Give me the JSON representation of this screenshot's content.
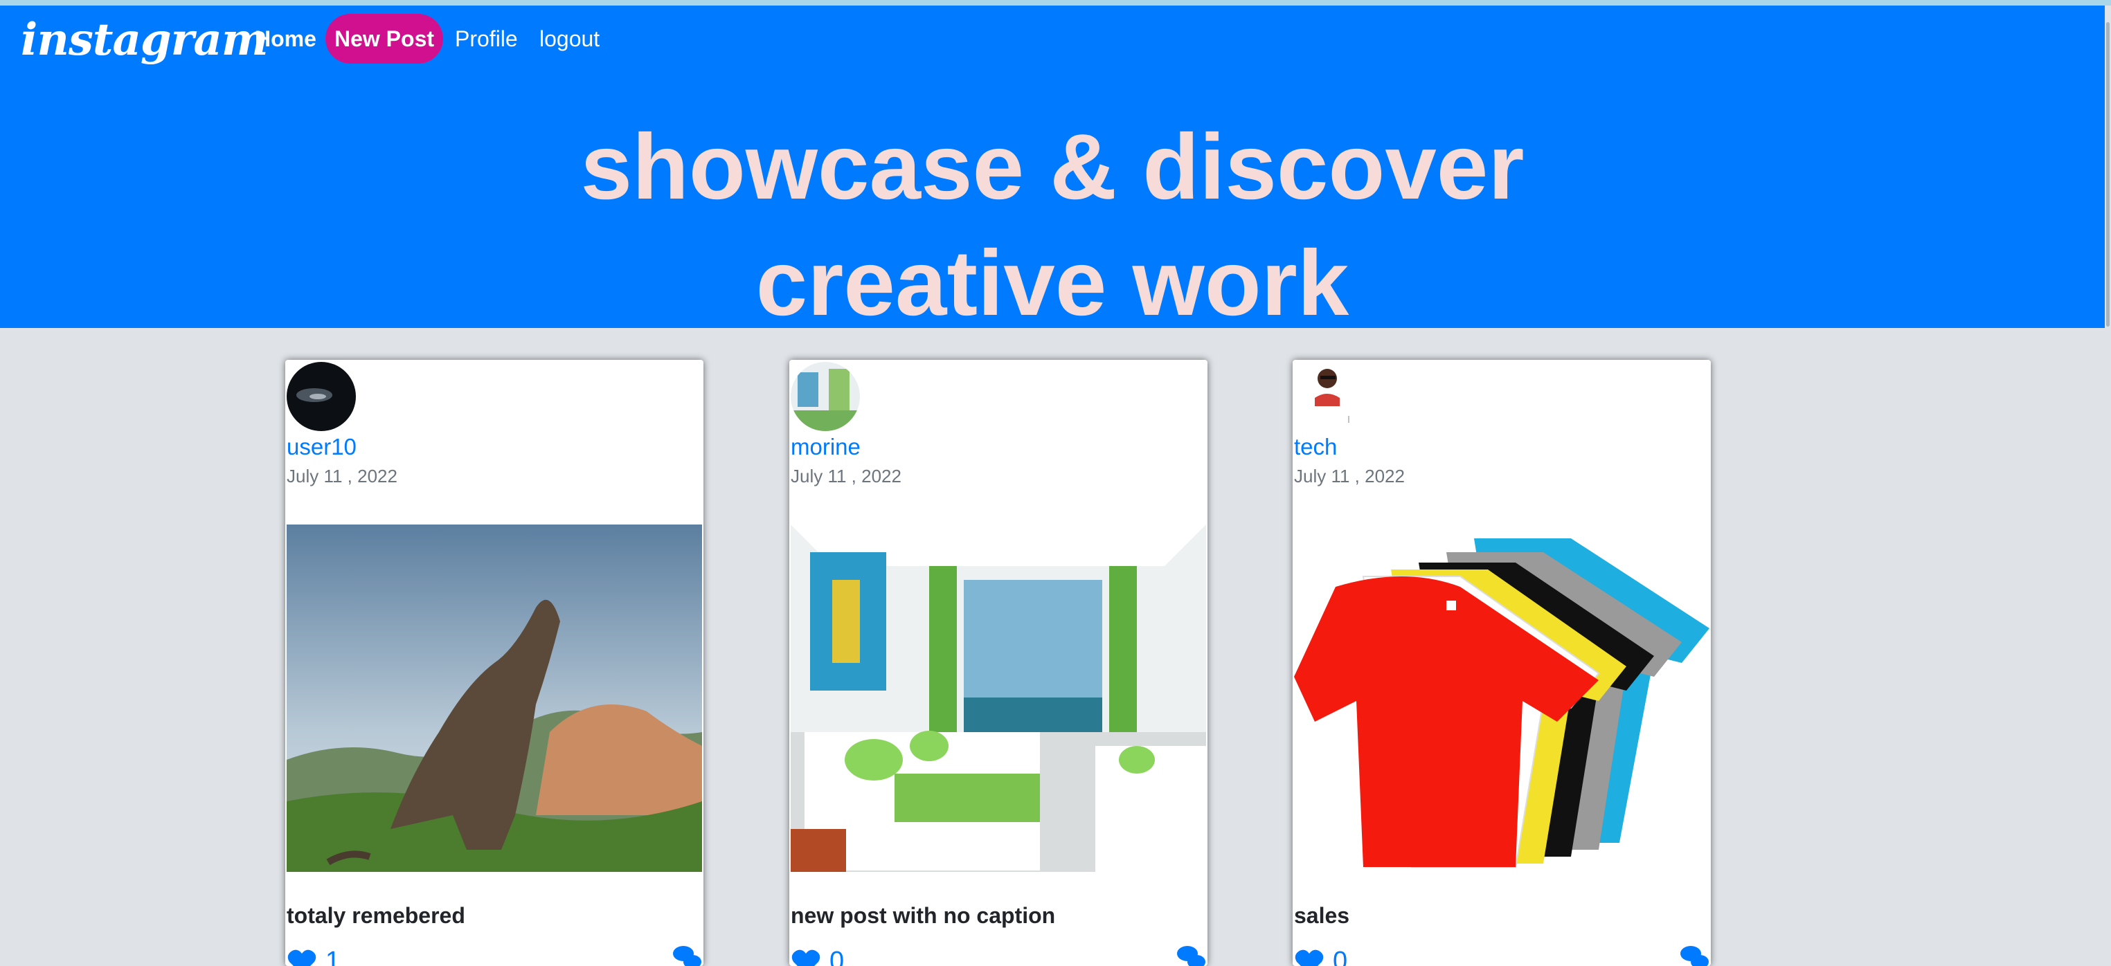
{
  "nav": {
    "logo": "instagram",
    "home": "Home",
    "new_post": "New Post",
    "profile": "Profile",
    "logout": "logout"
  },
  "hero": {
    "line1": "showcase & discover",
    "line2": "creative work"
  },
  "posts": [
    {
      "username": "user10",
      "date": "July 11 , 2022",
      "caption": "totaly remebered",
      "likes": "1"
    },
    {
      "username": "morine",
      "date": "July 11 , 2022",
      "caption": "new post with no caption",
      "likes": "0"
    },
    {
      "username": "tech",
      "date": "July 11 , 2022",
      "caption": "sales",
      "likes": "0"
    }
  ],
  "colors": {
    "primary": "#007bff",
    "new_post_bg": "#d1108f",
    "tagline": "#f7dbd8",
    "page_bg": "#dfe3e7"
  }
}
